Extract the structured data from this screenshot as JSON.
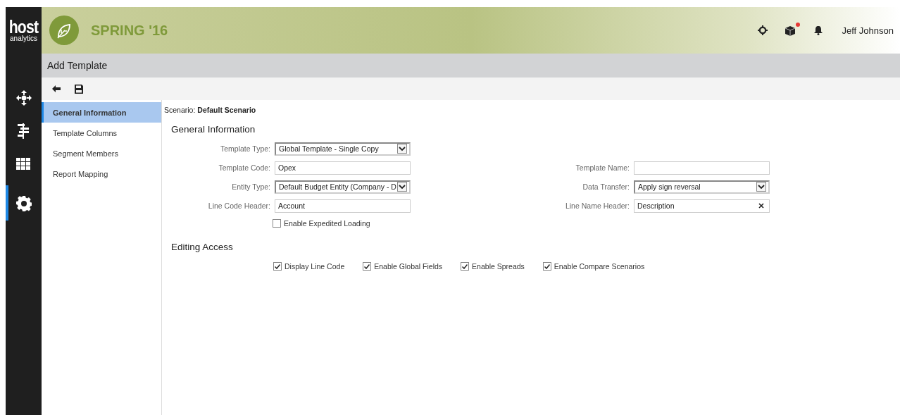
{
  "brand": {
    "logo_word": "host",
    "logo_sub": "analytics",
    "release": "SPRING '16"
  },
  "header": {
    "user": "Jeff Johnson",
    "notification_dot": true
  },
  "rail": [
    {
      "selected": false
    },
    {
      "selected": false
    },
    {
      "selected": false
    },
    {
      "selected": true
    }
  ],
  "page_title": "Add Template",
  "nav": [
    {
      "label": "General Information",
      "selected": true
    },
    {
      "label": "Template Columns",
      "selected": false
    },
    {
      "label": "Segment Members",
      "selected": false
    },
    {
      "label": "Report Mapping",
      "selected": false
    }
  ],
  "scenario": {
    "label": "Scenario:",
    "value": "Default Scenario"
  },
  "general": {
    "heading": "General Information",
    "rows": [
      [
        {
          "label": "Template Type:",
          "kind": "select",
          "value": "Global Template - Single Copy"
        },
        null
      ],
      [
        {
          "label": "Template Code:",
          "kind": "text",
          "value": "Opex"
        },
        {
          "label": "Template Name:",
          "kind": "text"
        }
      ],
      [
        {
          "label": "Entity Type:",
          "kind": "select",
          "value": "Default Budget Entity (Company - D"
        },
        {
          "label": "Data Transfer:",
          "kind": "select",
          "value": "Apply sign reversal"
        }
      ],
      [
        {
          "label": "Line Code Header:",
          "kind": "text",
          "value": "Account"
        },
        {
          "label": "Line Name Header:",
          "kind": "clearable",
          "value": "Description"
        }
      ]
    ],
    "option": {
      "label": "Enable Expedited Loading",
      "checked": false
    }
  },
  "editing": {
    "heading": "Editing Access",
    "options": [
      {
        "label": "Display Line Code",
        "checked": true
      },
      {
        "label": "Enable Global Fields",
        "checked": true
      },
      {
        "label": "Enable Spreads",
        "checked": true
      },
      {
        "label": "Enable Compare Scenarios",
        "checked": true
      }
    ]
  }
}
